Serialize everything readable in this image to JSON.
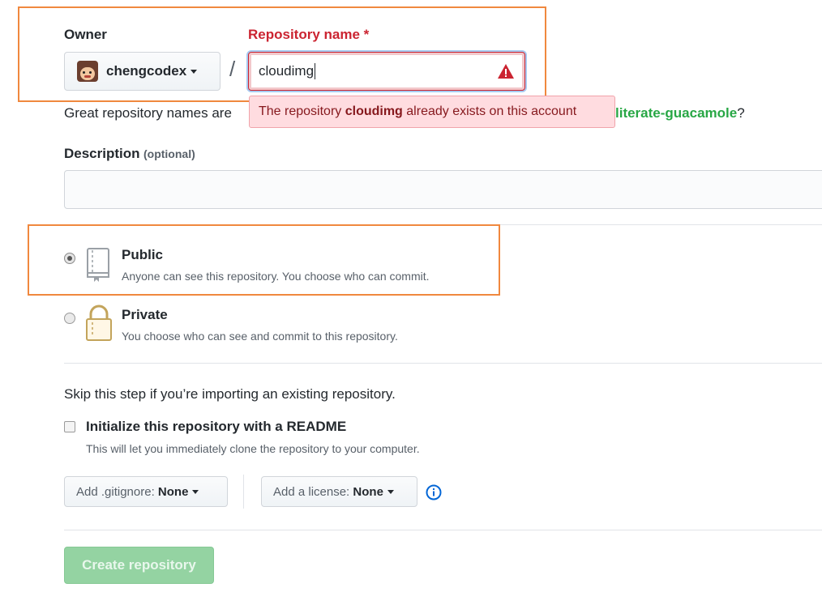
{
  "owner": {
    "label": "Owner",
    "username": "chengcodex"
  },
  "separator": "/",
  "repo_name": {
    "label": "Repository name",
    "required_mark": "*",
    "value": "cloudimg",
    "error_prefix": "The repository",
    "error_name": "cloudimg",
    "error_suffix": "already exists on this account"
  },
  "suggestion": {
    "prefix": "Great repository names are",
    "name": "literate-guacamole",
    "suffix": "?"
  },
  "description": {
    "label": "Description",
    "optional": "(optional)",
    "value": ""
  },
  "visibility": {
    "selected": "public",
    "public": {
      "title": "Public",
      "desc": "Anyone can see this repository. You choose who can commit."
    },
    "private": {
      "title": "Private",
      "desc": "You choose who can see and commit to this repository."
    }
  },
  "import_note": "Skip this step if you’re importing an existing repository.",
  "readme": {
    "label": "Initialize this repository with a README",
    "desc": "This will let you immediately clone the repository to your computer.",
    "checked": false
  },
  "gitignore": {
    "prefix": "Add .gitignore:",
    "value": "None"
  },
  "license": {
    "prefix": "Add a license:",
    "value": "None"
  },
  "create_button": "Create repository",
  "colors": {
    "highlight": "#f0883e",
    "error_text": "#cb2431",
    "error_bg": "#ffdce0",
    "link_green": "#28a745",
    "button_disabled": "#94d3a2",
    "info_blue": "#0366d6"
  }
}
